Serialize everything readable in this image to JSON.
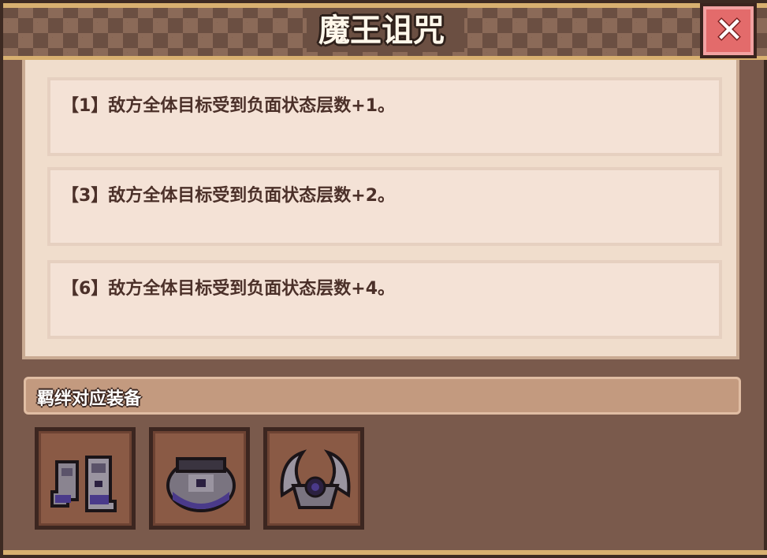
{
  "dialog": {
    "title": "魔王诅咒",
    "close_glyph": "✕"
  },
  "effects": [
    {
      "text": "【1】敌方全体目标受到负面状态层数+1。"
    },
    {
      "text": "【3】敌方全体目标受到负面状态层数+2。"
    },
    {
      "text": "【6】敌方全体目标受到负面状态层数+4。"
    }
  ],
  "equipment_section": {
    "title": "羁绊对应装备",
    "items": [
      {
        "icon": "dark-boots-icon"
      },
      {
        "icon": "dark-armor-icon"
      },
      {
        "icon": "dark-horned-helmet-icon"
      }
    ]
  },
  "colors": {
    "panel": "#7a5a4c",
    "title_bar": "#6b4f42",
    "gold_trim": "#d8b070",
    "close_button": "#e36b6b",
    "effect_card": "#f4e2d6",
    "section_header": "#c39a7f"
  }
}
